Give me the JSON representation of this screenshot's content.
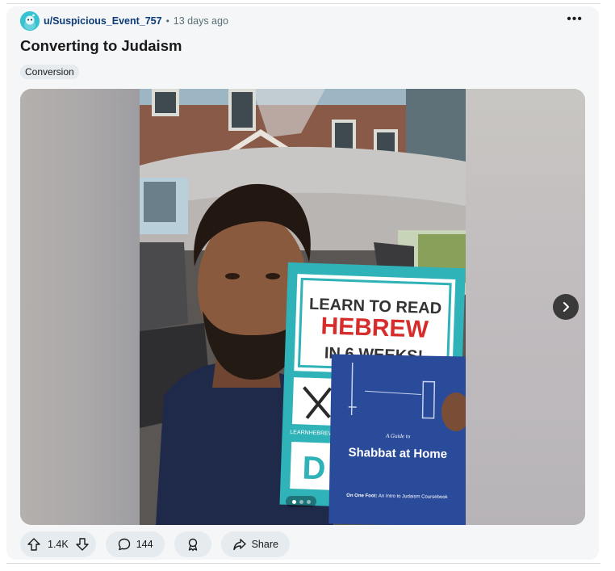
{
  "post": {
    "author": "u/Suspicious_Event_757",
    "separator": "•",
    "timestamp": "13 days ago",
    "more_label": "•••",
    "title": "Converting to Judaism",
    "flair": "Conversion"
  },
  "media": {
    "photo": {
      "book1": {
        "line1": "LEARN TO READ",
        "line2": "HEBREW",
        "line3": "IN 6 WEEKS!",
        "site": "LEARNHEBREW.TV"
      },
      "book2": {
        "subtitle": "A Guide to",
        "title": "Shabbat at Home",
        "series_bold": "On One Foot:",
        "series_rest": " An Intro to Judaism Coursebook"
      }
    },
    "carousel": {
      "count": 3,
      "active": 1
    }
  },
  "actions": {
    "vote_count": "1.4K",
    "comment_count": "144",
    "share_label": "Share"
  },
  "icons": {
    "avatar": "reddit-snoo-icon",
    "upvote": "upvote-arrow-icon",
    "downvote": "downvote-arrow-icon",
    "comment": "comment-bubble-icon",
    "award": "award-ribbon-icon",
    "share": "share-arrow-icon",
    "next": "chevron-right-icon"
  },
  "colors": {
    "author": "#0b3b78",
    "avatar": "#36c3d1",
    "pill_bg": "#e5ebee",
    "card_bg": "#f5f6f7"
  }
}
